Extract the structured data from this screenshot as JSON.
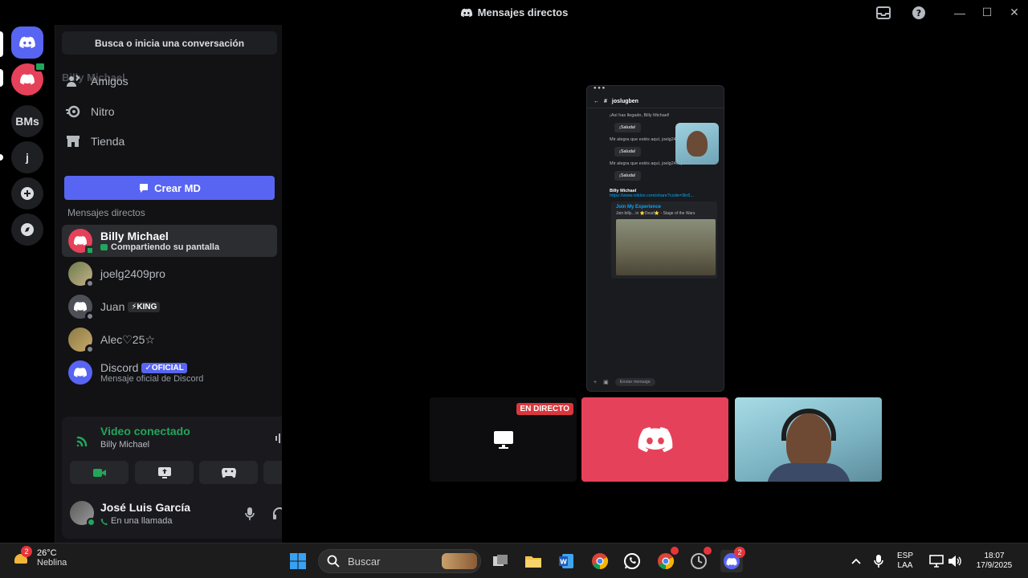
{
  "window": {
    "title": "Mensajes directos"
  },
  "servers": {
    "bms_label": "BMs",
    "j_label": "j"
  },
  "sidebar": {
    "search_label": "Busca o inicia una conversación",
    "ghost_label": "Billy Michael",
    "nav": [
      {
        "label": "Amigos",
        "icon": "friends-icon"
      },
      {
        "label": "Nitro",
        "icon": "nitro-icon"
      },
      {
        "label": "Tienda",
        "icon": "shop-icon"
      }
    ],
    "create_dm_label": "Crear MD",
    "dm_section_label": "Mensajes directos",
    "dms": [
      {
        "name": "Billy Michael",
        "sub": "Compartiendo su pantalla",
        "active": true
      },
      {
        "name": "joelg2409pro",
        "sub": ""
      },
      {
        "name": "Juan",
        "badge": "⚡KING"
      },
      {
        "name": "Alec♡25☆"
      },
      {
        "name": "Discord",
        "badge": "✓OFICIAL",
        "sub": "Mensaje oficial de Discord"
      }
    ]
  },
  "voice": {
    "status": "Video conectado",
    "channel": "Billy Michael",
    "user_name": "José Luis García",
    "user_status": "En una llamada"
  },
  "stream": {
    "live_label": "EN DIRECTO",
    "phone": {
      "channel": "joslugben",
      "msg1": "¡Así has llegado, Billy Michael!",
      "msg2": "Mir alegra que estés aquí, joelg2409pro",
      "msg3": "Mir alegra que estés aquí, joelg2409pro",
      "greet": "¡Saluda!",
      "author": "Billy Michael",
      "link": "https://www.roblox.com/share?code=3ln5...",
      "embed_title": "Join My Experience",
      "embed_desc": "Join billy... in ⭐Dead⭐ - Stage of the Wars",
      "composer": "Enviar mensaje"
    }
  },
  "taskbar": {
    "weather_temp": "26°C",
    "weather_desc": "Neblina",
    "weather_badge": "2",
    "search_placeholder": "Buscar",
    "lang_top": "ESP",
    "lang_bottom": "LAA",
    "time": "18:07",
    "date": "17/9/2025",
    "discord_badge": "2"
  },
  "colors": {
    "blurple": "#5865f2",
    "green": "#23a55a",
    "red": "#da373c",
    "discord_red": "#e6415a"
  }
}
